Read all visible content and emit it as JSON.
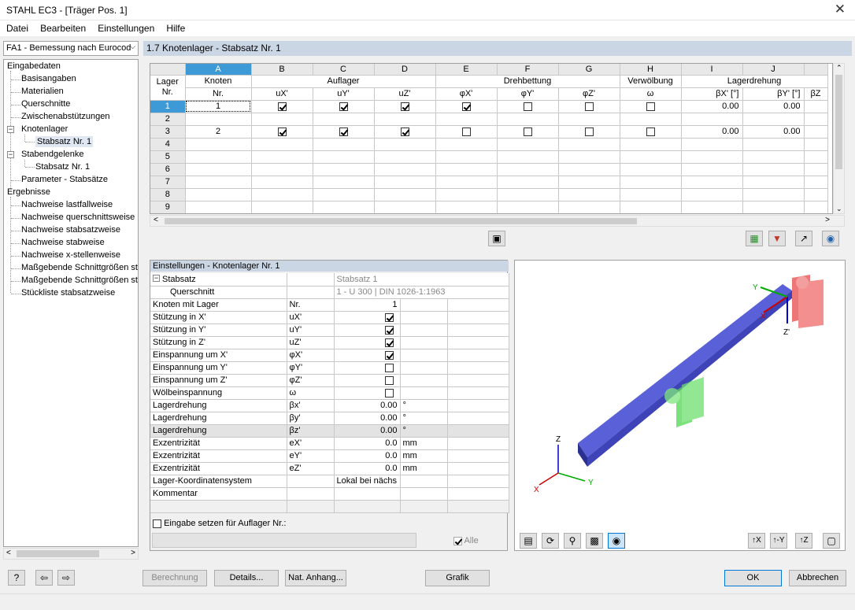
{
  "window": {
    "title": "STAHL EC3 - [Träger Pos. 1]",
    "close": "✕"
  },
  "menu": [
    "Datei",
    "Bearbeiten",
    "Einstellungen",
    "Hilfe"
  ],
  "module_select": "FA1 - Bemessung nach Eurocod",
  "tree": {
    "eingabedaten": "Eingabedaten",
    "basisangaben": "Basisangaben",
    "materialien": "Materialien",
    "querschnitte": "Querschnitte",
    "zwischen": "Zwischenabstützungen",
    "knotenlager": "Knotenlager",
    "stabsatz1": "Stabsatz Nr. 1",
    "stabendgelenke": "Stabendgelenke",
    "stabsatz1b": "Stabsatz Nr. 1",
    "parameter": "Parameter - Stabsätze",
    "ergebnisse": "Ergebnisse",
    "r1": "Nachweise lastfallweise",
    "r2": "Nachweise querschnittsweise",
    "r3": "Nachweise stabsatzweise",
    "r4": "Nachweise stabweise",
    "r5": "Nachweise x-stellenweise",
    "r6": "Maßgebende Schnittgrößen sta",
    "r7": "Maßgebende Schnittgrößen sta",
    "r8": "Stückliste stabsatzweise"
  },
  "panel_title": "1.7 Knotenlager - Stabsatz Nr. 1",
  "grid": {
    "col_letters": [
      "A",
      "B",
      "C",
      "D",
      "E",
      "F",
      "G",
      "H",
      "I",
      "J"
    ],
    "lager": "Lager",
    "nr": "Nr.",
    "knoten": "Knoten",
    "knoten_nr": "Nr.",
    "auflager": "Auflager",
    "drehbettung": "Drehbettung",
    "verwoelbung": "Verwölbung",
    "lagerdrehung": "Lagerdrehung",
    "sub": [
      "uX'",
      "uY'",
      "uZ'",
      "φX'",
      "φY'",
      "φZ'",
      "ω",
      "βX' [°]",
      "βY' [°]",
      "βZ"
    ],
    "rows": [
      {
        "nr": "1",
        "knoten": "1",
        "checks": [
          true,
          true,
          true,
          true,
          false,
          false,
          false
        ],
        "bx": "0.00",
        "by": "0.00"
      },
      {
        "nr": "2",
        "knoten": "",
        "checks": null,
        "bx": "",
        "by": ""
      },
      {
        "nr": "3",
        "knoten": "2",
        "checks": [
          true,
          true,
          true,
          false,
          false,
          false,
          false
        ],
        "bx": "0.00",
        "by": "0.00"
      },
      {
        "nr": "4",
        "knoten": "",
        "checks": null,
        "bx": "",
        "by": ""
      },
      {
        "nr": "5",
        "knoten": "",
        "checks": null,
        "bx": "",
        "by": ""
      },
      {
        "nr": "6",
        "knoten": "",
        "checks": null,
        "bx": "",
        "by": ""
      },
      {
        "nr": "7",
        "knoten": "",
        "checks": null,
        "bx": "",
        "by": ""
      },
      {
        "nr": "8",
        "knoten": "",
        "checks": null,
        "bx": "",
        "by": ""
      },
      {
        "nr": "9",
        "knoten": "",
        "checks": null,
        "bx": "",
        "by": ""
      }
    ]
  },
  "settings": {
    "header": "Einstellungen - Knotenlager Nr. 1",
    "stabsatz_label": "Stabsatz",
    "stabsatz_value": "Stabsatz 1",
    "querschnitt_label": "Querschnitt",
    "querschnitt_value": "1 - U 300 | DIN 1026-1:1963",
    "rows": [
      {
        "label": "Knoten mit Lager",
        "sym": "Nr.",
        "value": "1",
        "unit": "",
        "type": "num"
      },
      {
        "label": "Stützung in X'",
        "sym": "uX'",
        "value": true,
        "unit": "",
        "type": "cb"
      },
      {
        "label": "Stützung in Y'",
        "sym": "uY'",
        "value": true,
        "unit": "",
        "type": "cb"
      },
      {
        "label": "Stützung in Z'",
        "sym": "uZ'",
        "value": true,
        "unit": "",
        "type": "cb"
      },
      {
        "label": "Einspannung um X'",
        "sym": "φX'",
        "value": true,
        "unit": "",
        "type": "cb"
      },
      {
        "label": "Einspannung um Y'",
        "sym": "φY'",
        "value": false,
        "unit": "",
        "type": "cb"
      },
      {
        "label": "Einspannung um Z'",
        "sym": "φZ'",
        "value": false,
        "unit": "",
        "type": "cb"
      },
      {
        "label": "Wölbeinspannung",
        "sym": "ω",
        "value": false,
        "unit": "",
        "type": "cb"
      },
      {
        "label": "Lagerdrehung",
        "sym": "βx'",
        "value": "0.00",
        "unit": "°",
        "type": "num"
      },
      {
        "label": "Lagerdrehung",
        "sym": "βy'",
        "value": "0.00",
        "unit": "°",
        "type": "num"
      },
      {
        "label": "Lagerdrehung",
        "sym": "βz'",
        "value": "0.00",
        "unit": "°",
        "type": "num",
        "hl": true
      },
      {
        "label": "Exzentrizität",
        "sym": "eX'",
        "value": "0.0",
        "unit": "mm",
        "type": "num"
      },
      {
        "label": "Exzentrizität",
        "sym": "eY'",
        "value": "0.0",
        "unit": "mm",
        "type": "num"
      },
      {
        "label": "Exzentrizität",
        "sym": "eZ'",
        "value": "0.0",
        "unit": "mm",
        "type": "num"
      },
      {
        "label": "Lager-Koordinatensystem",
        "sym": "",
        "value": "Lokal bei nächs",
        "unit": "",
        "type": "text"
      },
      {
        "label": "Kommentar",
        "sym": "",
        "value": "",
        "unit": "",
        "type": "text"
      }
    ],
    "eingabe_label": "Eingabe setzen für Auflager Nr.:",
    "alle": "Alle"
  },
  "axes": {
    "x": "X",
    "y": "Y",
    "z": "Z",
    "xl": "X'",
    "yl": "Y",
    "zl": "Z'"
  },
  "buttons": {
    "berechnung": "Berechnung",
    "details": "Details...",
    "nat_anhang": "Nat. Anhang...",
    "grafik": "Grafik",
    "ok": "OK",
    "abbrechen": "Abbrechen"
  }
}
